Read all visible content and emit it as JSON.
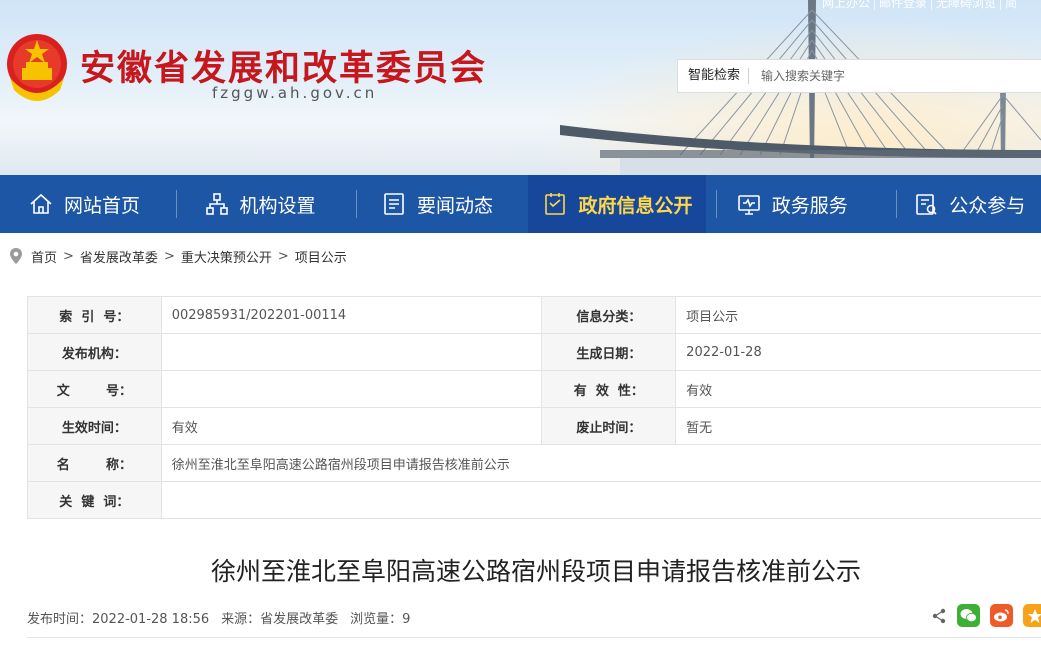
{
  "header": {
    "site_title": "安徽省发展和改革委员会",
    "site_domain": "fzggw.ah.gov.cn",
    "top_links": [
      "网上办公",
      "邮件登录",
      "无障碍浏览",
      "简"
    ],
    "search_label": "智能检索",
    "search_placeholder": "输入搜索关键字"
  },
  "nav": {
    "items": [
      {
        "label": "网站首页",
        "icon": "home-icon"
      },
      {
        "label": "机构设置",
        "icon": "org-icon"
      },
      {
        "label": "要闻动态",
        "icon": "news-icon"
      },
      {
        "label": "政府信息公开",
        "icon": "info-icon",
        "active": true
      },
      {
        "label": "政务服务",
        "icon": "monitor-icon"
      },
      {
        "label": "公众参与",
        "icon": "participate-icon"
      }
    ]
  },
  "breadcrumb": [
    "首页",
    "省发展改革委",
    "重大决策预公开",
    "项目公示"
  ],
  "meta": {
    "index_no_label": "索  引  号：",
    "index_no": "002985931/202201-00114",
    "category_label": "信息分类：",
    "category": "项目公示",
    "publisher_label": "发布机构：",
    "publisher": "",
    "created_label": "生成日期：",
    "created": "2022-01-28",
    "doc_no_label": "文        号：",
    "doc_no": "",
    "validity_label": "有  效  性：",
    "validity": "有效",
    "effective_label": "生效时间：",
    "effective": "有效",
    "expire_label": "废止时间：",
    "expire": "暂无",
    "name_label": "名        称：",
    "name": "徐州至淮北至阜阳高速公路宿州段项目申请报告核准前公示",
    "keywords_label": "关  键  词：",
    "keywords": ""
  },
  "article": {
    "title": "徐州至淮北至阜阳高速公路宿州段项目申请报告核准前公示",
    "publish_time": "发布时间：2022-01-28 18:56",
    "source": "来源：省发展改革委",
    "views": "浏览量：9"
  },
  "colors": {
    "nav_bg": "#1d56a5",
    "nav_active_text": "#ffd84a",
    "title_red": "#c8161d",
    "wechat_green": "#3cb034",
    "weibo_orange": "#f05a28",
    "qzone_orange": "#f7a31a"
  }
}
